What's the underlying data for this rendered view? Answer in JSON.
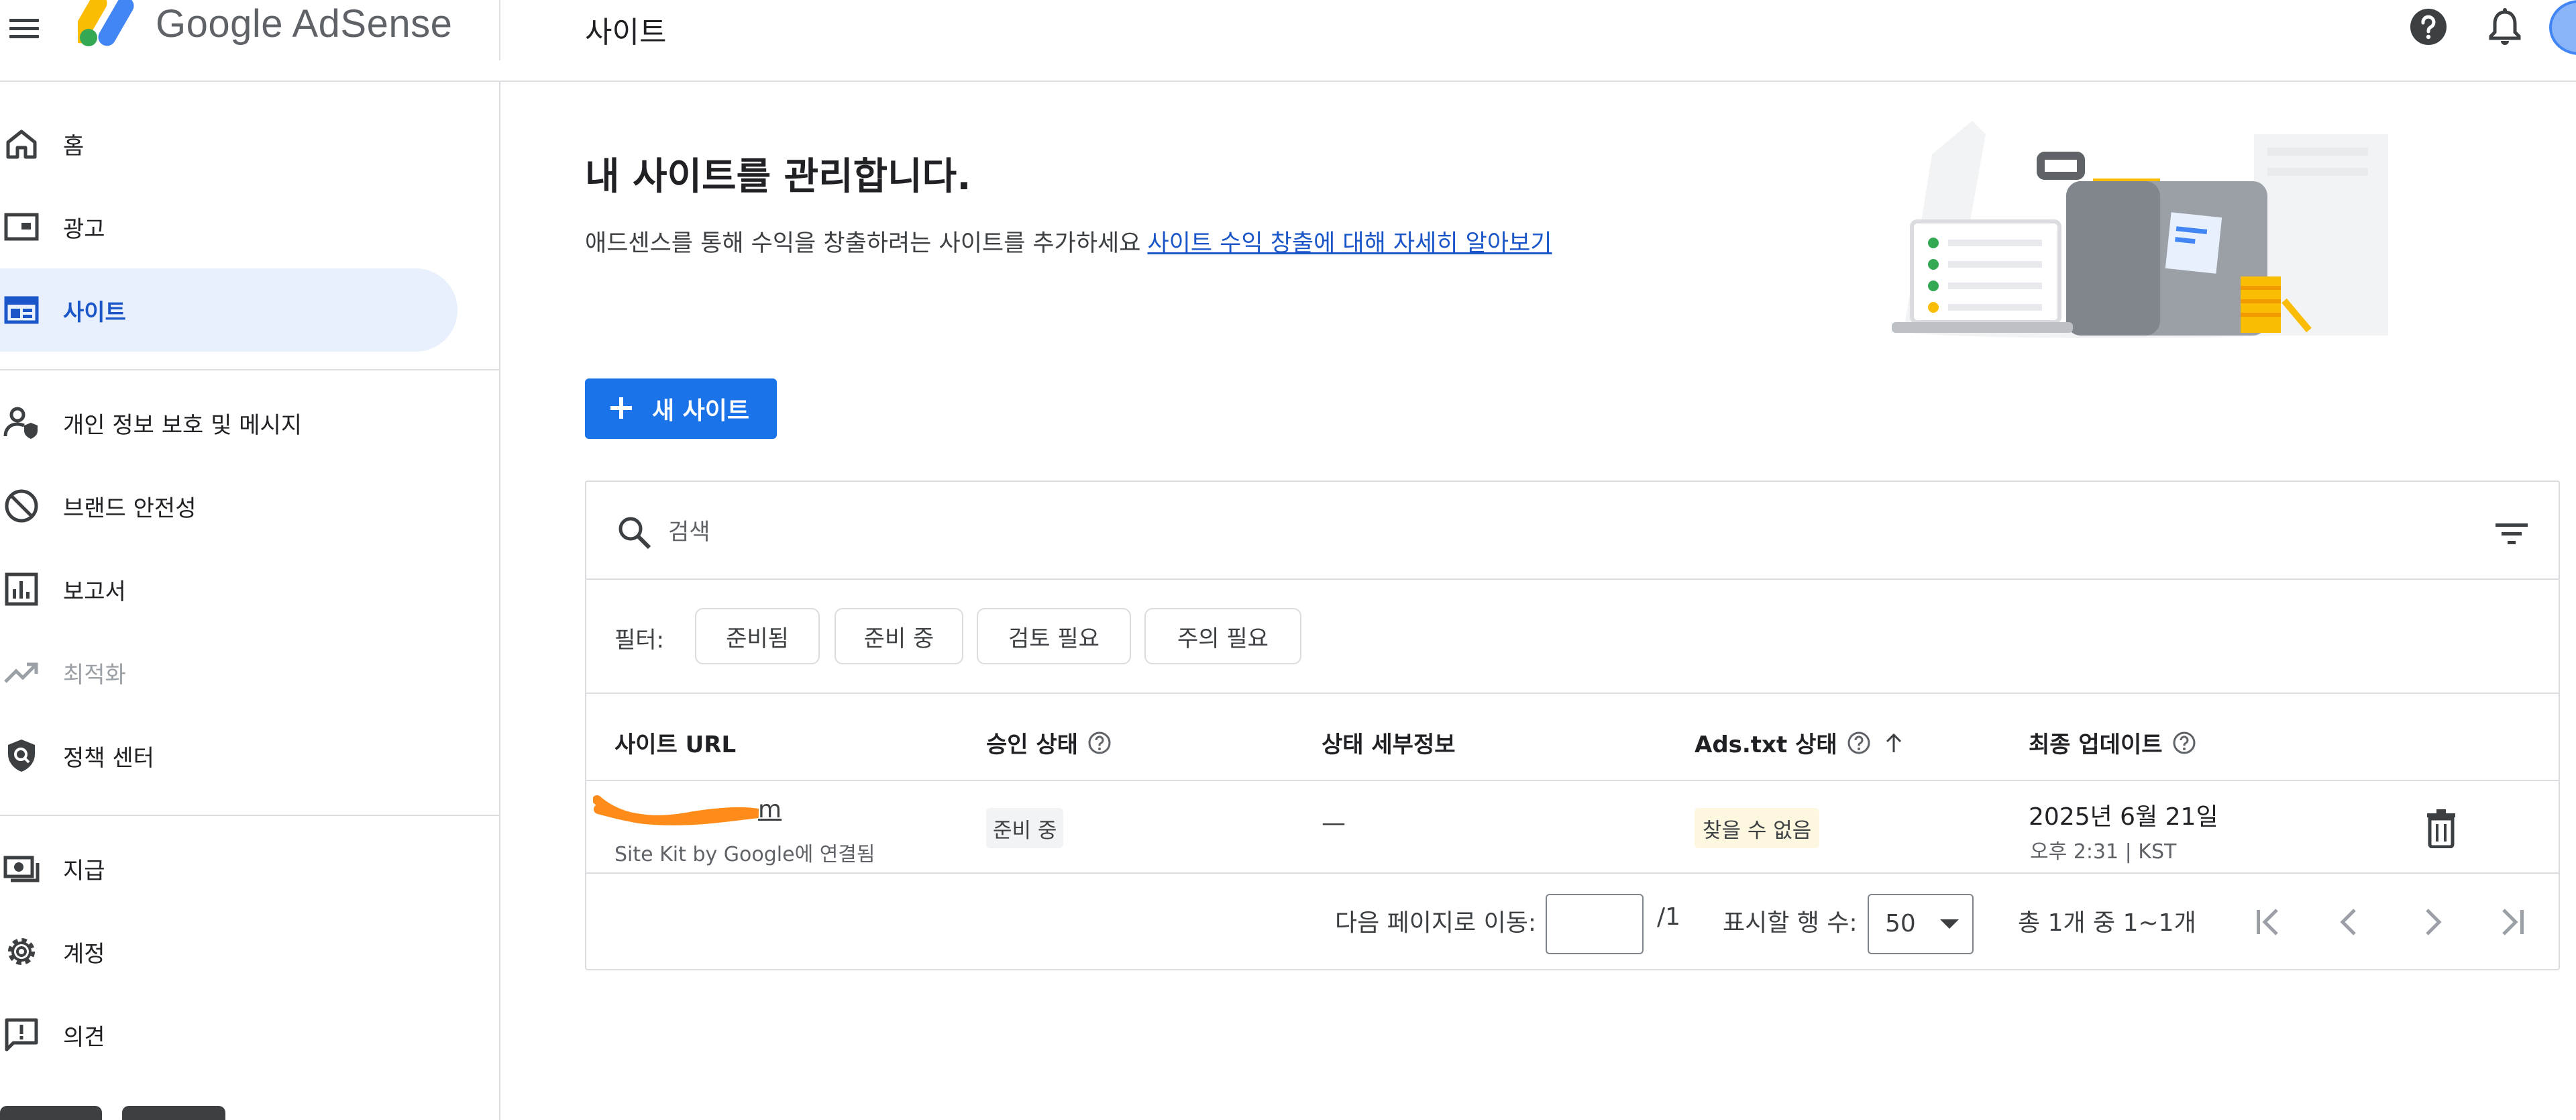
{
  "app": {
    "brand": "Google AdSense",
    "page_name": "사이트"
  },
  "colors": {
    "primary": "#1a73e8",
    "active_bg": "#e8f0fe",
    "active_text": "#1a56c8",
    "warning_badge_bg": "#fef7e0",
    "neutral_badge_bg": "#f1f3f4"
  },
  "sidebar": {
    "items": [
      {
        "label": "홈",
        "icon": "home-icon"
      },
      {
        "label": "광고",
        "icon": "ads-icon"
      },
      {
        "label": "사이트",
        "icon": "sites-icon",
        "active": true
      },
      {
        "label": "개인 정보 보호 및 메시지",
        "icon": "privacy-messaging-icon"
      },
      {
        "label": "브랜드 안전성",
        "icon": "block-icon"
      },
      {
        "label": "보고서",
        "icon": "reports-icon"
      },
      {
        "label": "최적화",
        "icon": "trending-up-icon",
        "disabled": true
      },
      {
        "label": "정책 센터",
        "icon": "policy-shield-icon"
      },
      {
        "label": "지급",
        "icon": "payments-icon"
      },
      {
        "label": "계정",
        "icon": "gear-icon"
      },
      {
        "label": "의견",
        "icon": "feedback-icon"
      }
    ]
  },
  "main": {
    "title": "내 사이트를 관리합니다.",
    "subtitle": "애드센스를 통해 수익을 창출하려는 사이트를 추가하세요",
    "learn_more_link": "사이트 수익 창출에 대해 자세히 알아보기",
    "new_site_button": "새 사이트"
  },
  "search": {
    "placeholder": "검색"
  },
  "filters": {
    "label": "필터:",
    "chips": [
      "준비됨",
      "준비 중",
      "검토 필요",
      "주의 필요"
    ]
  },
  "table": {
    "columns": [
      "사이트 URL",
      "승인 상태",
      "상태 세부정보",
      "Ads.txt 상태",
      "최종 업데이트"
    ],
    "rows": [
      {
        "site_url_visible": "m",
        "site_sub": "Site Kit by Google에 연결됨",
        "approval_status": "준비 중",
        "status_detail": "—",
        "ads_txt_status": "찾을 수 없음",
        "updated_date": "2025년 6월 21일",
        "updated_time": "오후 2:31 | KST"
      }
    ]
  },
  "pagination": {
    "go_to_page_label": "다음 페이지로 이동:",
    "page_input_value": "",
    "total_pages": "/1",
    "rows_label": "표시할 행 수:",
    "rows_per_page": "50",
    "summary": "총 1개 중 1~1개"
  }
}
